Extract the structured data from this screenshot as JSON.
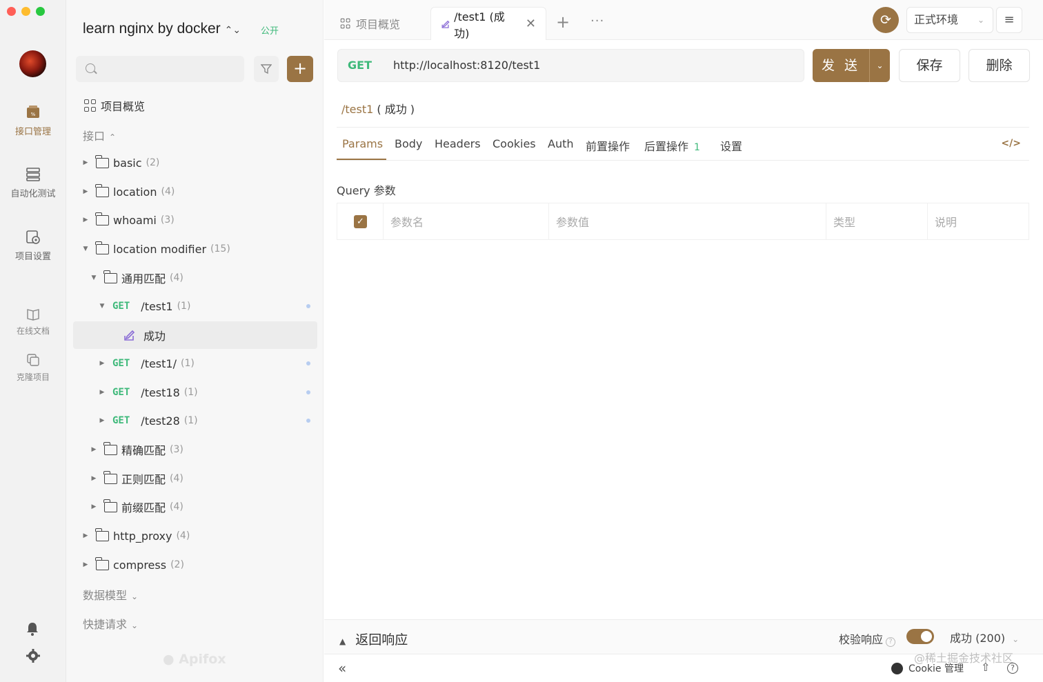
{
  "rail": {
    "items": [
      {
        "label": "接口管理",
        "icon": "api-manage-icon",
        "active": true
      },
      {
        "label": "自动化测试",
        "icon": "automation-icon",
        "active": false
      },
      {
        "label": "项目设置",
        "icon": "project-settings-icon",
        "active": false
      },
      {
        "label": "在线文档",
        "icon": "book-icon",
        "active": false
      },
      {
        "label": "克隆项目",
        "icon": "clone-icon",
        "active": false
      }
    ]
  },
  "sidebar": {
    "project_title": "learn nginx by docker",
    "public_badge": "公开",
    "overview_label": "项目概览",
    "api_section": "接口",
    "tree": [
      {
        "type": "folder",
        "name": "basic",
        "count": "(2)",
        "expanded": false,
        "level": 0
      },
      {
        "type": "folder",
        "name": "location",
        "count": "(4)",
        "expanded": false,
        "level": 0
      },
      {
        "type": "folder",
        "name": "whoami",
        "count": "(3)",
        "expanded": false,
        "level": 0
      },
      {
        "type": "folder",
        "name": "location modifier",
        "count": "(15)",
        "expanded": true,
        "level": 0
      },
      {
        "type": "folder",
        "name": "通用匹配",
        "count": "(4)",
        "expanded": true,
        "level": 1
      },
      {
        "type": "api",
        "method": "GET",
        "name": "/test1",
        "count": "(1)",
        "expanded": true,
        "level": 2
      },
      {
        "type": "case",
        "name": "成功",
        "level": 3,
        "selected": true
      },
      {
        "type": "api",
        "method": "GET",
        "name": "/test1/",
        "count": "(1)",
        "expanded": false,
        "level": 2
      },
      {
        "type": "api",
        "method": "GET",
        "name": "/test18",
        "count": "(1)",
        "expanded": false,
        "level": 2
      },
      {
        "type": "api",
        "method": "GET",
        "name": "/test28",
        "count": "(1)",
        "expanded": false,
        "level": 2
      },
      {
        "type": "folder",
        "name": "精确匹配",
        "count": "(3)",
        "expanded": false,
        "level": 1
      },
      {
        "type": "folder",
        "name": "正则匹配",
        "count": "(4)",
        "expanded": false,
        "level": 1
      },
      {
        "type": "folder",
        "name": "前缀匹配",
        "count": "(4)",
        "expanded": false,
        "level": 1
      },
      {
        "type": "folder",
        "name": "http_proxy",
        "count": "(4)",
        "expanded": false,
        "level": 0
      },
      {
        "type": "folder",
        "name": "compress",
        "count": "(2)",
        "expanded": false,
        "level": 0
      }
    ],
    "data_model_section": "数据模型",
    "quick_request_section": "快捷请求",
    "watermark": "Apifox"
  },
  "tabs": [
    {
      "label": "项目概览",
      "active": false
    },
    {
      "label": "/test1 (成功)",
      "active": true
    }
  ],
  "env": {
    "label": "正式环境"
  },
  "request": {
    "method": "GET",
    "url": "http://localhost:8120/test1",
    "send_label": "发 送",
    "save_label": "保存",
    "delete_label": "删除",
    "case_path": "/test1",
    "case_name": "( 成功 )"
  },
  "req_tabs": [
    "Params",
    "Body",
    "Headers",
    "Cookies",
    "Auth",
    "前置操作",
    "后置操作",
    "设置"
  ],
  "post_ops_badge": "1",
  "query": {
    "title": "Query 参数",
    "columns": [
      "参数名",
      "参数值",
      "类型",
      "说明"
    ]
  },
  "response": {
    "title": "返回响应",
    "validate_label": "校验响应",
    "selected": "成功 (200)"
  },
  "footer": {
    "cookie_label": "Cookie 管理",
    "watermark": "@稀土掘金技术社区"
  },
  "colors": {
    "accent": "#9a7444",
    "get_method": "#3eb97a"
  }
}
